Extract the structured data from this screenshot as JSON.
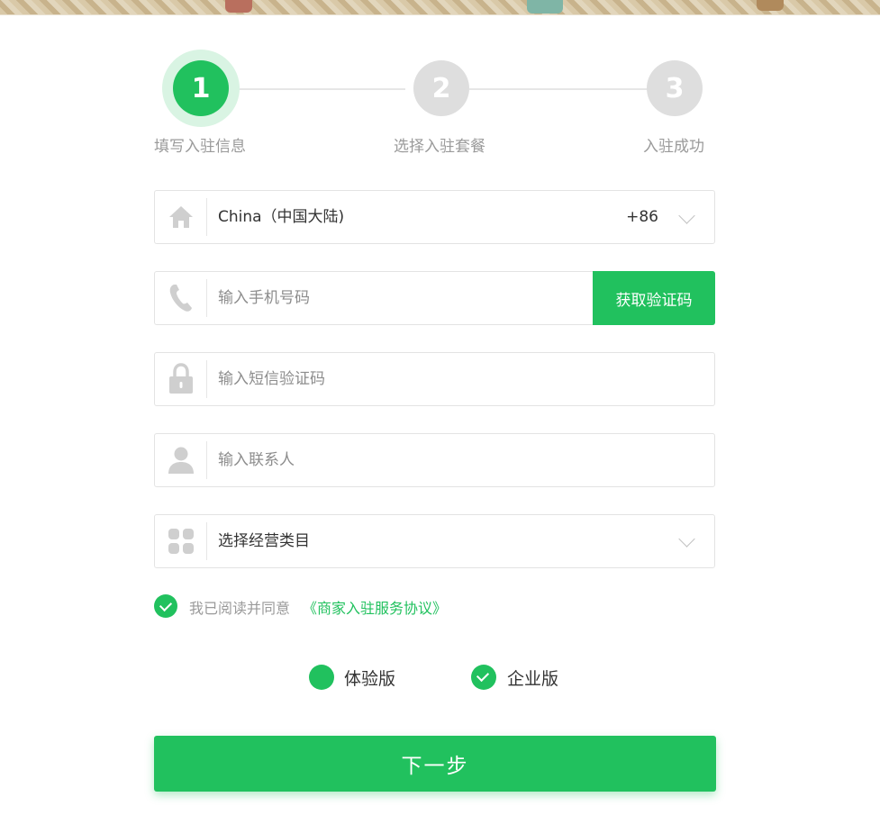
{
  "steps": [
    {
      "number": "1",
      "label": "填写入驻信息",
      "active": true
    },
    {
      "number": "2",
      "label": "选择入驻套餐",
      "active": false
    },
    {
      "number": "3",
      "label": "入驻成功",
      "active": false
    }
  ],
  "form": {
    "country": {
      "value": "China（中国大陆)",
      "code": "+86",
      "icon": "house-icon"
    },
    "phone": {
      "placeholder": "输入手机号码",
      "button_label": "获取验证码",
      "icon": "phone-icon"
    },
    "sms_code": {
      "placeholder": "输入短信验证码",
      "icon": "lock-icon"
    },
    "contact": {
      "placeholder": "输入联系人",
      "icon": "user-icon"
    },
    "category": {
      "value": "选择经营类目",
      "icon": "grid-icon"
    }
  },
  "agreement": {
    "text": "我已阅读并同意",
    "link": "《商家入驻服务协议》",
    "checked": true
  },
  "plans": [
    {
      "label": "体验版",
      "state": "selected-dot"
    },
    {
      "label": "企业版",
      "state": "checked"
    }
  ],
  "next_button": "下一步",
  "colors": {
    "accent": "#21c15e",
    "inactive_step": "#dedede",
    "placeholder": "#8d8d8d"
  }
}
